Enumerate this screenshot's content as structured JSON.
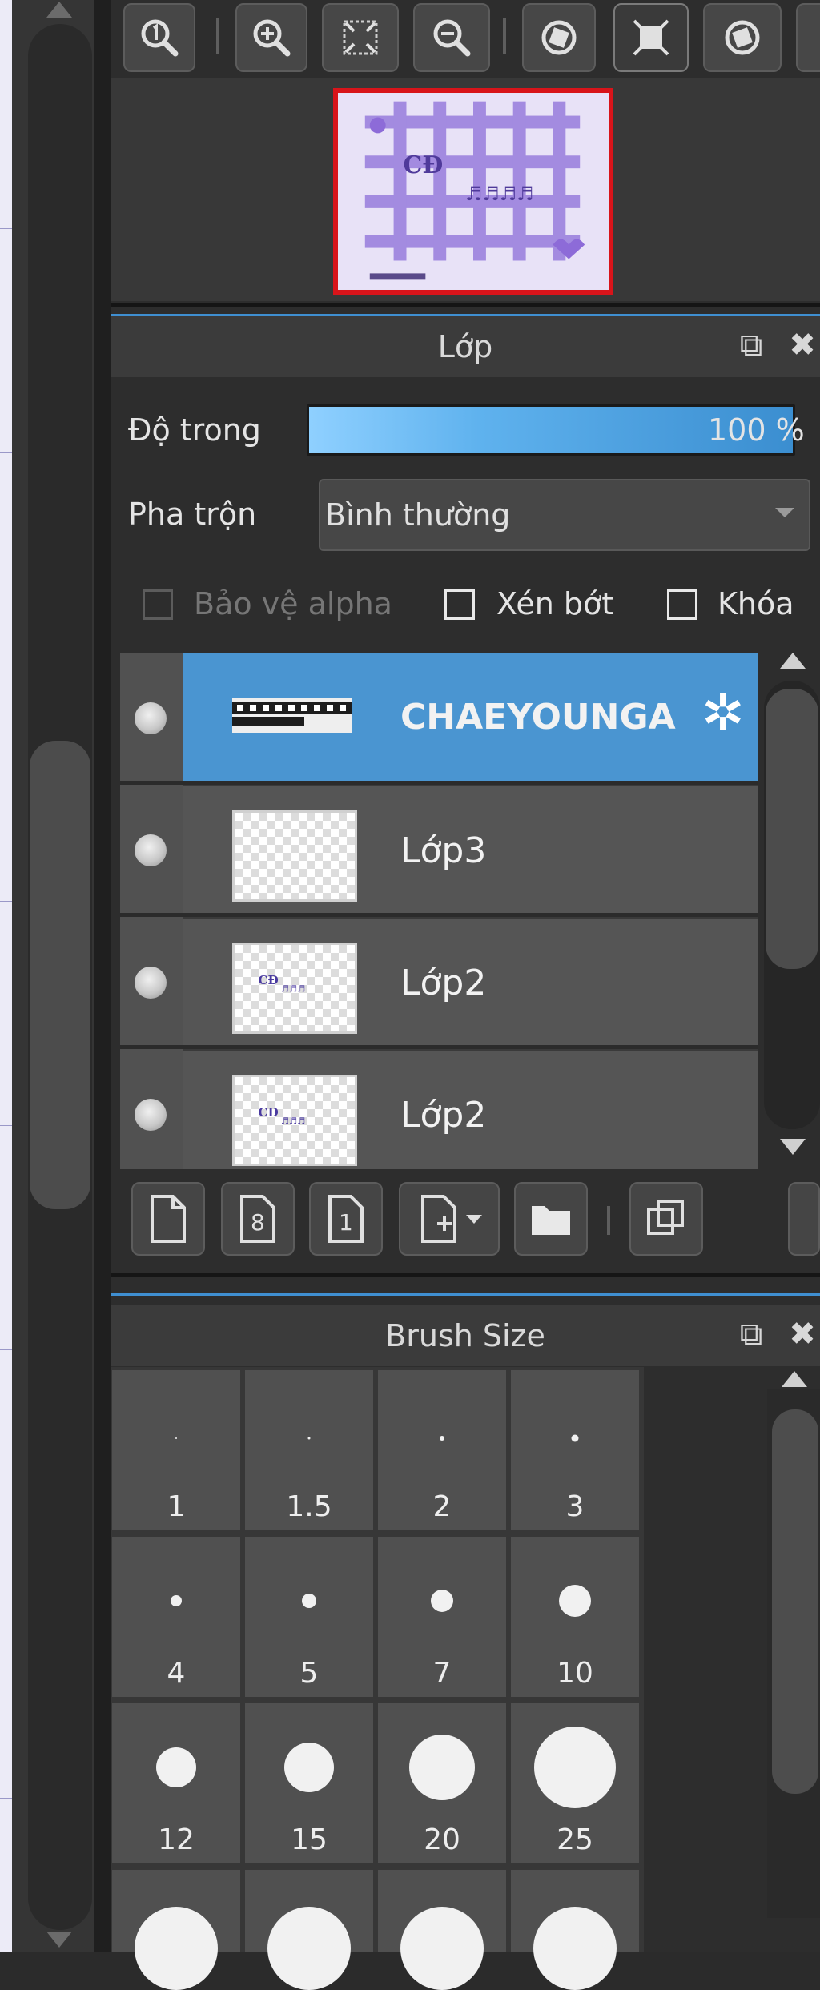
{
  "colors": {
    "accent": "#4a95d1",
    "navigator_border": "#d8141a",
    "panel_bg": "#2d2d2d"
  },
  "toolbar": {
    "icons": [
      "zoom-actual-icon",
      "zoom-in-icon",
      "fit-screen-icon",
      "zoom-out-icon",
      "rotate-left-icon",
      "fullscreen-icon",
      "rotate-right-icon"
    ]
  },
  "layer_panel": {
    "title": "Lớp",
    "opacity_label": "Độ trong",
    "opacity_value": "100 %",
    "opacity_fraction": 1.0,
    "blend_label": "Pha trộn",
    "blend_value": "Bình thường",
    "checkboxes": [
      {
        "label": "Bảo vệ alpha",
        "checked": false,
        "enabled": false
      },
      {
        "label": "Xén bớt",
        "checked": false,
        "enabled": true
      },
      {
        "label": "Khóa",
        "checked": false,
        "enabled": true
      }
    ],
    "layers": [
      {
        "name": "CHAEYOUNGA",
        "selected": true
      },
      {
        "name": "Lớp3",
        "selected": false
      },
      {
        "name": "Lớp2",
        "selected": false
      },
      {
        "name": "Lớp2",
        "selected": false
      }
    ],
    "bottom_buttons": [
      "new-layer-icon",
      "new-layer-8bit-icon",
      "new-layer-1bit-icon",
      "add-layer-menu-icon",
      "folder-icon",
      "duplicate-layer-icon"
    ]
  },
  "brush_panel": {
    "title": "Brush Size",
    "sizes": [
      "1",
      "1.5",
      "2",
      "3",
      "4",
      "5",
      "7",
      "10",
      "12",
      "15",
      "20",
      "25",
      "",
      "",
      "",
      ""
    ]
  }
}
